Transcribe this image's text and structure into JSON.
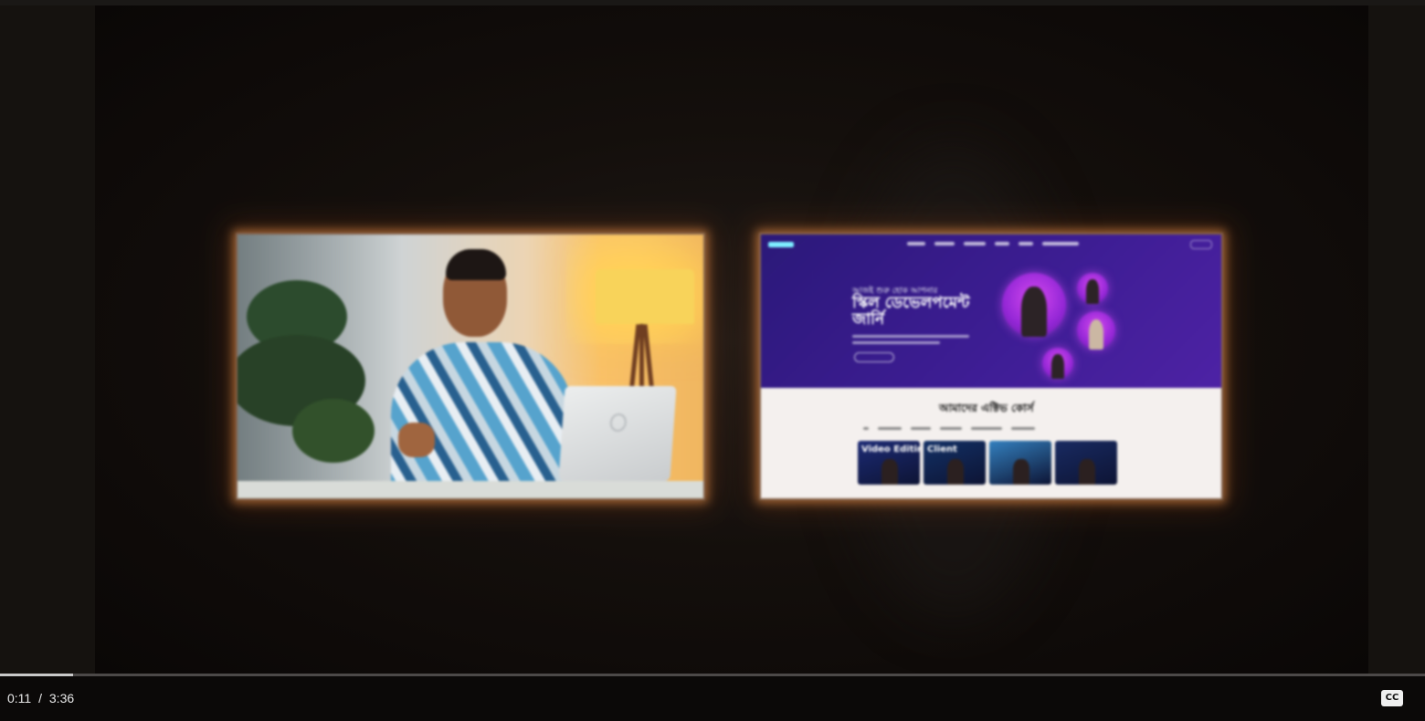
{
  "player": {
    "current_time": "0:11",
    "separator": "/",
    "duration": "3:36",
    "progress_fraction": 0.051,
    "cc_label": "CC"
  },
  "video": {
    "right_panel": {
      "hero_kicker": "আজই শুরু হোক আপনার",
      "hero_title": "স্কিল ডেভেলপমেন্ট জার্নি",
      "section_title": "আমাদের এক্টিভ কোর্স",
      "course_cards": [
        {
          "label": "Video Editing",
          "color": "#1e2a6b"
        },
        {
          "label": "Client",
          "color": "#16305e"
        },
        {
          "label": "",
          "color": "#3c7fb5"
        },
        {
          "label": "",
          "color": "#1b2a5a"
        }
      ]
    }
  },
  "colors": {
    "panel_glow": "#ff9f5a",
    "hero_purple": "#3b1f86",
    "progress": "#c9c9c9"
  }
}
